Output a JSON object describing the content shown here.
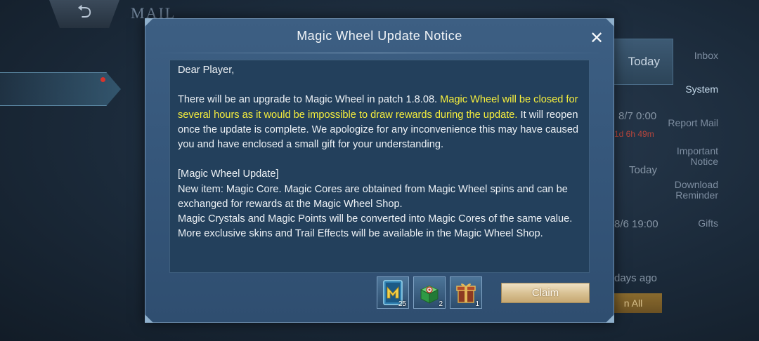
{
  "background": {
    "header_title": "MAIL",
    "sidebar": [
      {
        "label": "Inbox",
        "active": false
      },
      {
        "label": "System",
        "active": true
      },
      {
        "label": "Report Mail",
        "active": false
      },
      {
        "label": "Important\nNotice",
        "active": false
      },
      {
        "label": "Download\nReminder",
        "active": false
      },
      {
        "label": "Gifts",
        "active": false
      }
    ],
    "mail_dates": [
      "Today",
      "8/7 0:00",
      "1d 6h 49m",
      "Today",
      "8/6 19:00",
      "days ago"
    ],
    "claim_all_label": "n All"
  },
  "dialog": {
    "title": "Magic Wheel Update Notice",
    "greeting": "Dear Player,",
    "para1_before": "There will be an upgrade to Magic Wheel in patch 1.8.08. ",
    "para1_highlight": "Magic Wheel will be closed for several hours as it would be impossible to draw rewards during the update.",
    "para1_after": " It will reopen once the update is complete. We apologize for any inconvenience this may have caused you and have enclosed a small gift for your understanding.",
    "section_heading": "[Magic Wheel Update]",
    "line1": "New item: Magic Core. Magic Cores are obtained from Magic Wheel spins and can be exchanged for rewards at the Magic Wheel Shop.",
    "line2": "Magic Crystals and Magic Points will be converted into Magic Cores of the same value.",
    "line3": "More exclusive skins and Trail Effects will be available in the Magic Wheel Shop.",
    "rewards": [
      {
        "icon": "magic-core-card-icon",
        "count": "25"
      },
      {
        "icon": "green-gift-box-icon",
        "count": "2"
      },
      {
        "icon": "red-gold-gift-box-icon",
        "count": "1"
      }
    ],
    "claim_label": "Claim",
    "colors": {
      "highlight": "#f7ef3c",
      "panel": "#23405c",
      "dialog": "#3a5b80"
    }
  }
}
